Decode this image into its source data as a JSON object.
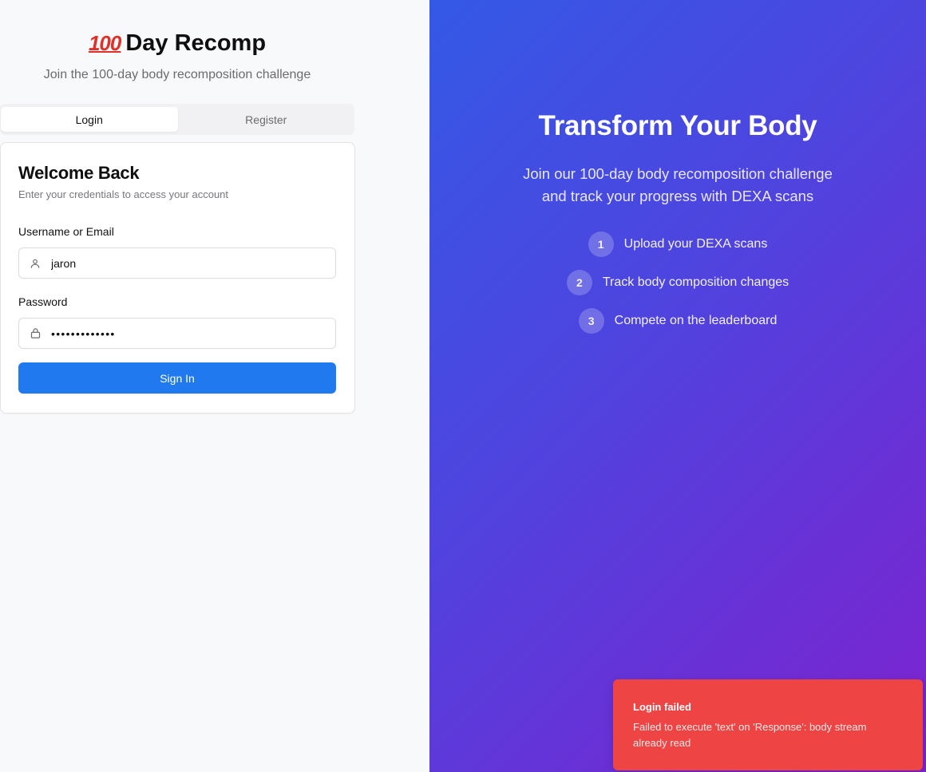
{
  "brand": {
    "emoji": "100",
    "title": "Day Recomp",
    "tagline": "Join the 100-day body recomposition challenge"
  },
  "tabs": [
    {
      "label": "Login",
      "active": true
    },
    {
      "label": "Register",
      "active": false
    }
  ],
  "login_card": {
    "title": "Welcome Back",
    "subtitle": "Enter your credentials to access your account",
    "username_label": "Username or Email",
    "username_value": "jaron",
    "password_label": "Password",
    "password_mask": "•••••••••••••",
    "submit_label": "Sign In"
  },
  "hero": {
    "title": "Transform Your Body",
    "description_line1": "Join our 100-day body recomposition challenge",
    "description_line2": "and track your progress with DEXA scans",
    "steps": [
      {
        "num": "1",
        "label": "Upload your DEXA scans"
      },
      {
        "num": "2",
        "label": "Track body composition changes"
      },
      {
        "num": "3",
        "label": "Compete on the leaderboard"
      }
    ]
  },
  "toast": {
    "title": "Login failed",
    "message": "Failed to execute 'text' on 'Response': body stream already read"
  },
  "icons": {
    "username_field": "user-icon",
    "password_field": "lock-icon"
  },
  "colors": {
    "primary": "#2079ef",
    "toast_bg": "#ef4444",
    "gradient_start": "#3459e6",
    "gradient_end": "#7e24cf"
  }
}
